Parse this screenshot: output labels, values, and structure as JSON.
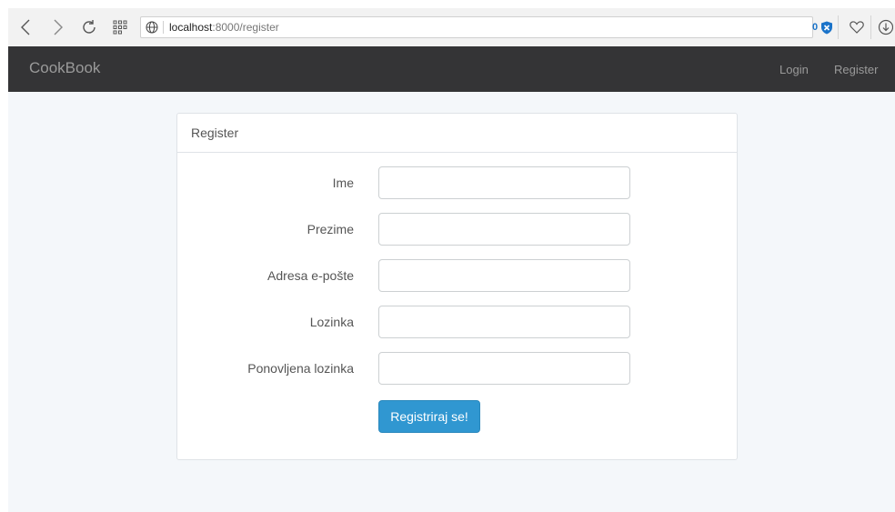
{
  "browser": {
    "url_host": "localhost",
    "url_path": ":8000/register",
    "shield_count": "0"
  },
  "navbar": {
    "brand": "CookBook",
    "login": "Login",
    "register": "Register"
  },
  "panel": {
    "heading": "Register",
    "fields": [
      {
        "label": "Ime",
        "value": ""
      },
      {
        "label": "Prezime",
        "value": ""
      },
      {
        "label": "Adresa e-pošte",
        "value": ""
      },
      {
        "label": "Lozinka",
        "value": ""
      },
      {
        "label": "Ponovljena lozinka",
        "value": ""
      }
    ],
    "submit_label": "Registriraj se!"
  },
  "colors": {
    "navbar_bg": "#343436",
    "page_bg": "#f4f7fa",
    "button_primary": "#3097d1"
  },
  "icons": [
    "back-icon",
    "forward-icon",
    "reload-icon",
    "speed-dial-icon",
    "globe-icon",
    "shield-icon",
    "heart-icon",
    "download-icon"
  ]
}
